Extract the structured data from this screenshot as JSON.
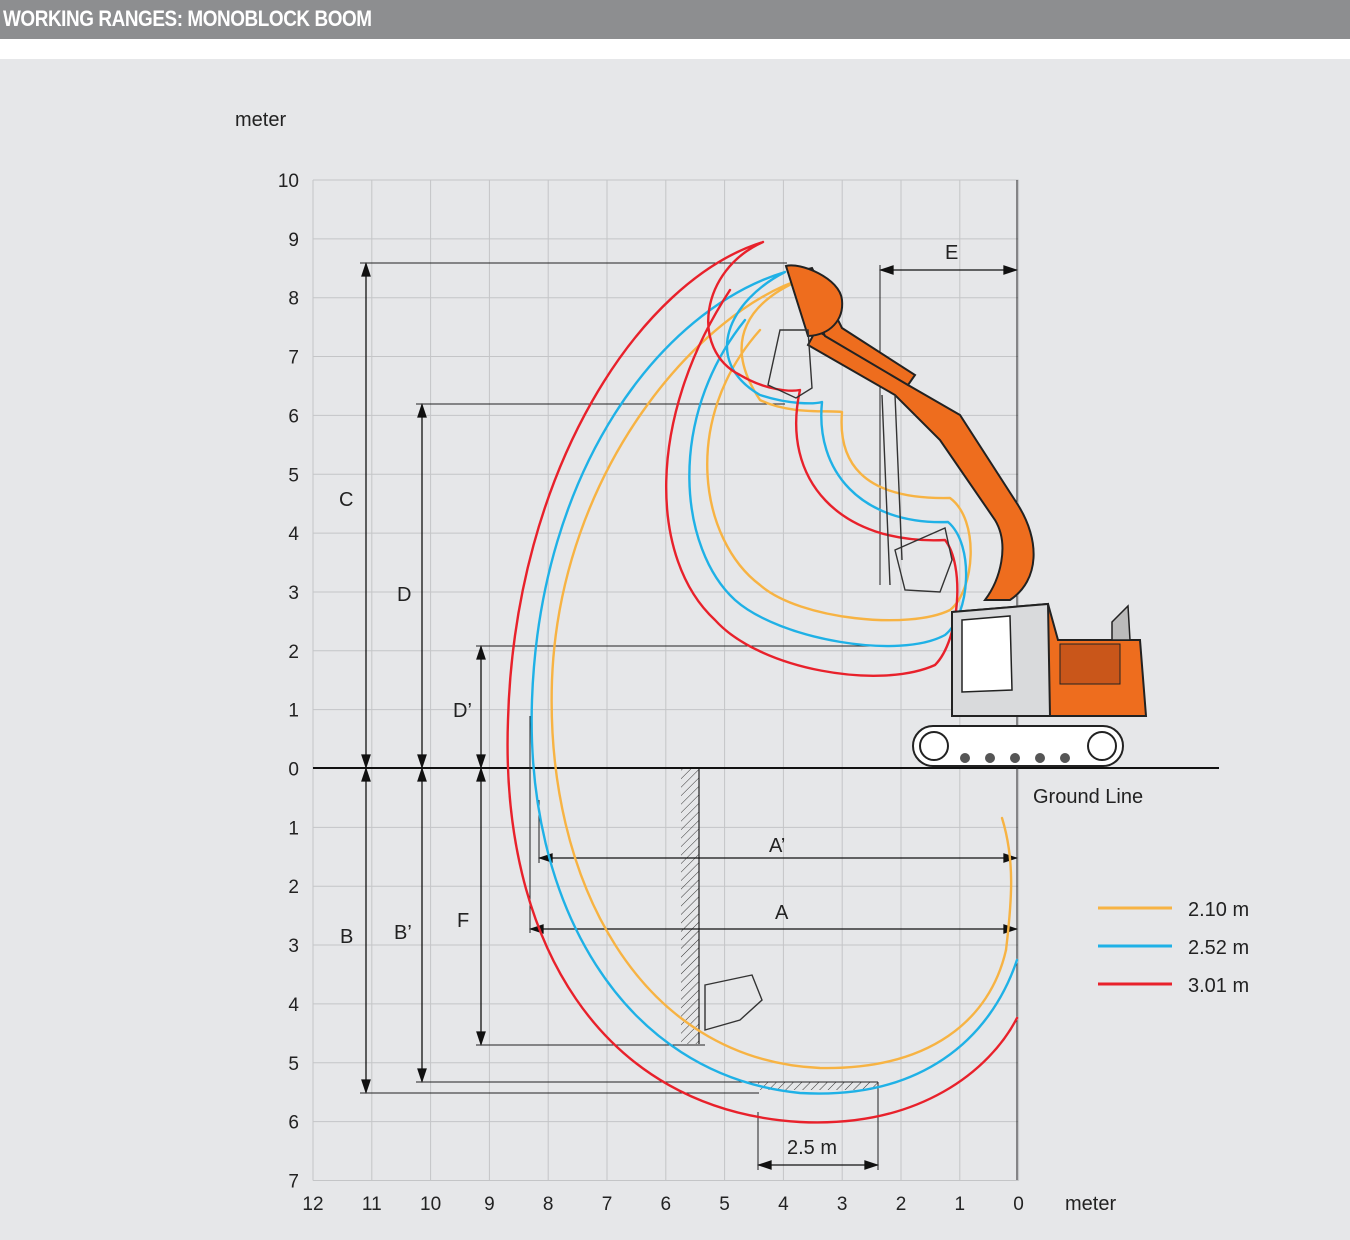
{
  "header": {
    "title": "WORKING RANGES: MONOBLOCK BOOM"
  },
  "axes": {
    "unit_label": "meter",
    "y_ticks": [
      "10",
      "9",
      "8",
      "7",
      "6",
      "5",
      "4",
      "3",
      "2",
      "1",
      "0",
      "1",
      "2",
      "3",
      "4",
      "5",
      "6",
      "7"
    ],
    "x_ticks": [
      "12",
      "11",
      "10",
      "9",
      "8",
      "7",
      "6",
      "5",
      "4",
      "3",
      "2",
      "1",
      "0"
    ]
  },
  "dimensions": {
    "A": "A",
    "A_prime": "A’",
    "B": "B",
    "B_prime": "B’",
    "C": "C",
    "D": "D",
    "D_prime": "D’",
    "E": "E",
    "F": "F",
    "width_2_5": "2.5 m"
  },
  "ground_line": "Ground Line",
  "legend": [
    {
      "label": "2.10 m",
      "color": "#f7b343"
    },
    {
      "label": "2.52 m",
      "color": "#1fb1e6"
    },
    {
      "label": "3.01 m",
      "color": "#e8212b"
    }
  ],
  "colors": {
    "machine_orange": "#ee6d1e",
    "grid": "#c4c5c7"
  }
}
